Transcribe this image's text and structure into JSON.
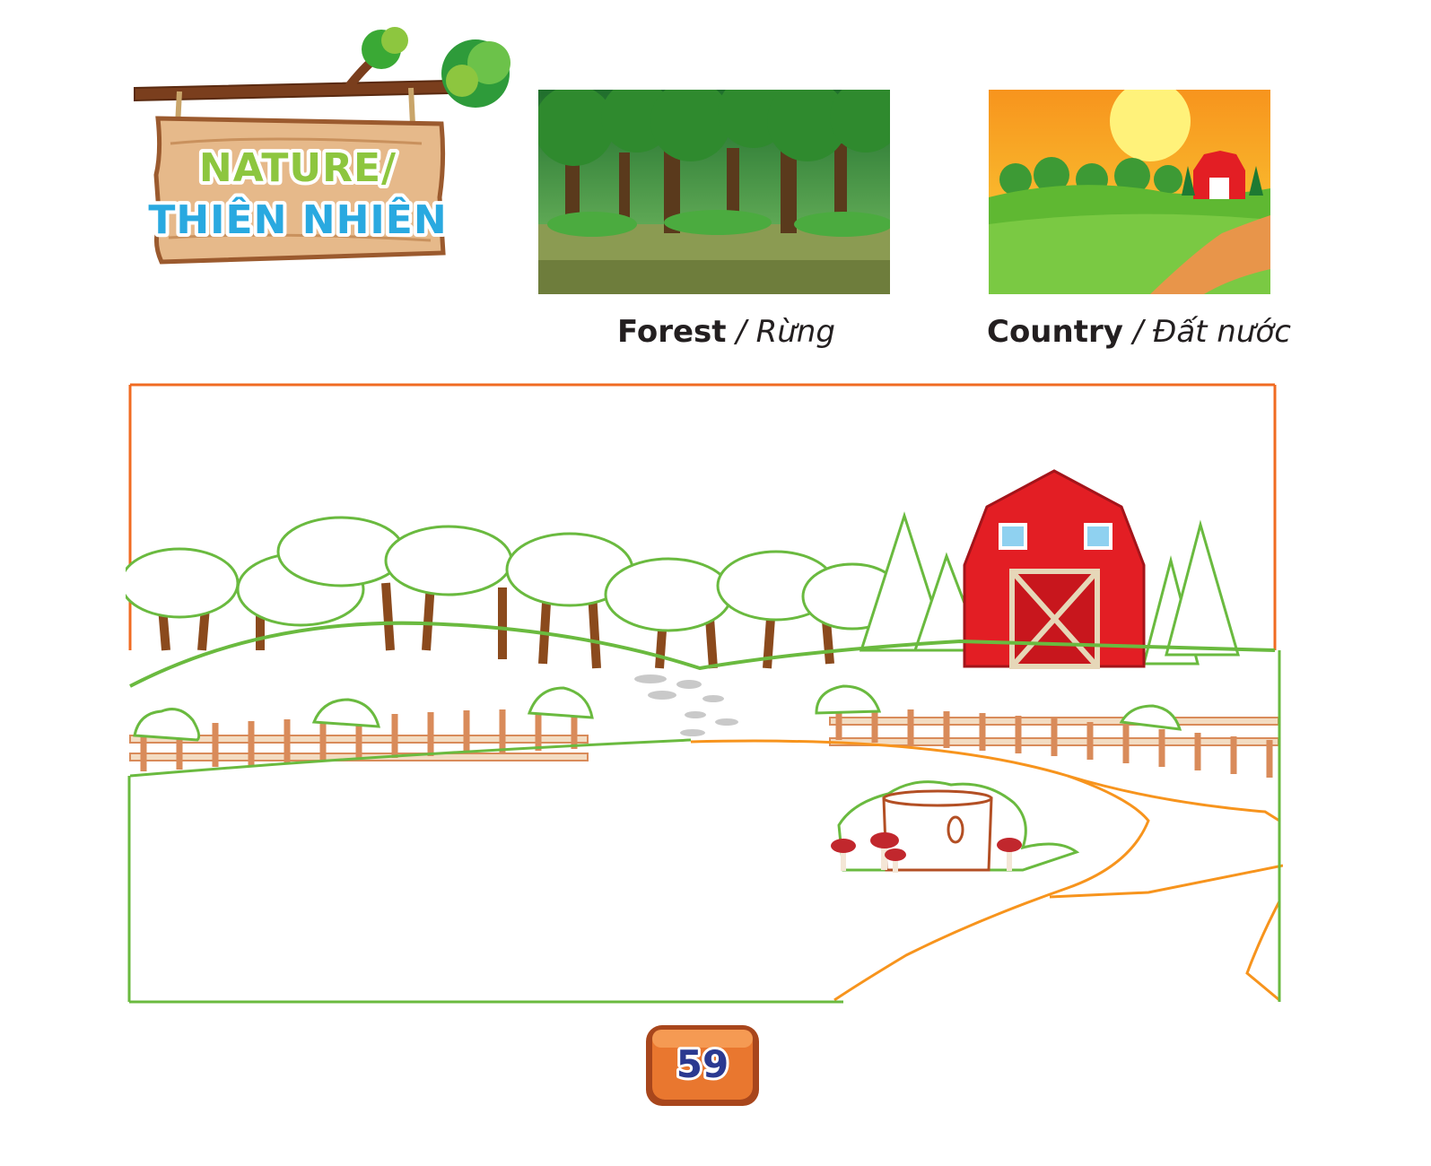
{
  "sign": {
    "line1": "NATURE/",
    "line2": "THIÊN NHIÊN"
  },
  "pictures": [
    {
      "word_en": "Forest",
      "word_vi": "/ Rừng"
    },
    {
      "word_en": "Country",
      "word_vi": "/ Đất nước"
    }
  ],
  "page_number": "59",
  "colors": {
    "frame_top": "#f06b22",
    "frame_outline": "#6aba3f",
    "path_outline": "#f7941d",
    "barn": "#e31e24",
    "sign_line1": "#8dc63f",
    "sign_line2": "#29a9e0"
  }
}
